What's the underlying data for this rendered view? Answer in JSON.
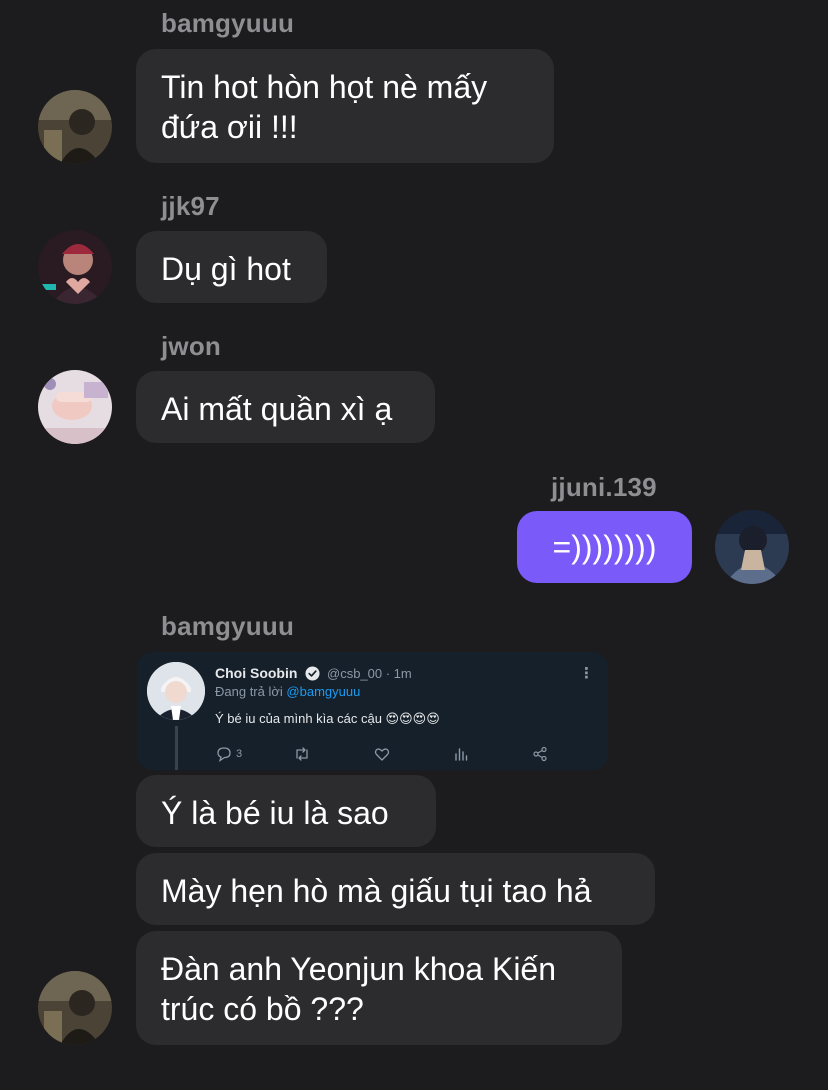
{
  "messages": [
    {
      "sender": "bamgyuuu",
      "lines": [
        "Tin hot hòn họt nè mấy",
        "đứa ơii !!!"
      ]
    },
    {
      "sender": "jjk97",
      "lines": [
        "Dụ gì hot"
      ]
    },
    {
      "sender": "jwon",
      "lines": [
        "Ai mất quần xì ạ"
      ]
    },
    {
      "sender": "jjuni.139",
      "lines": [
        "=))))))))"
      ]
    },
    {
      "sender": "bamgyuuu"
    },
    {
      "lines": [
        "Ý là bé iu là sao"
      ]
    },
    {
      "lines": [
        "Mày hẹn hò mà giấu tụi tao hả"
      ]
    },
    {
      "lines": [
        "Đàn anh Yeonjun khoa Kiến",
        "trúc có bồ ???"
      ]
    }
  ],
  "tweet": {
    "author_name": "Choi Soobin",
    "handle_time": "@csb_00 · 1m",
    "replying_prefix": "Đang trả lời",
    "replying_to": "@bamgyuuu",
    "text": "Ý bé iu của mình kìa các cậu 😍😍😍😍",
    "reply_count": "3",
    "icons": [
      "more-icon",
      "verified-icon",
      "reply-icon",
      "retweet-icon",
      "like-icon",
      "views-icon",
      "share-icon"
    ]
  },
  "colors": {
    "background": "#1c1c1e",
    "bubble_other": "#2c2c2e",
    "bubble_mine": "#7a5af8",
    "sender_name": "#8e8e93",
    "tweet_background": "#15202b",
    "tweet_link": "#1d9bf0"
  }
}
